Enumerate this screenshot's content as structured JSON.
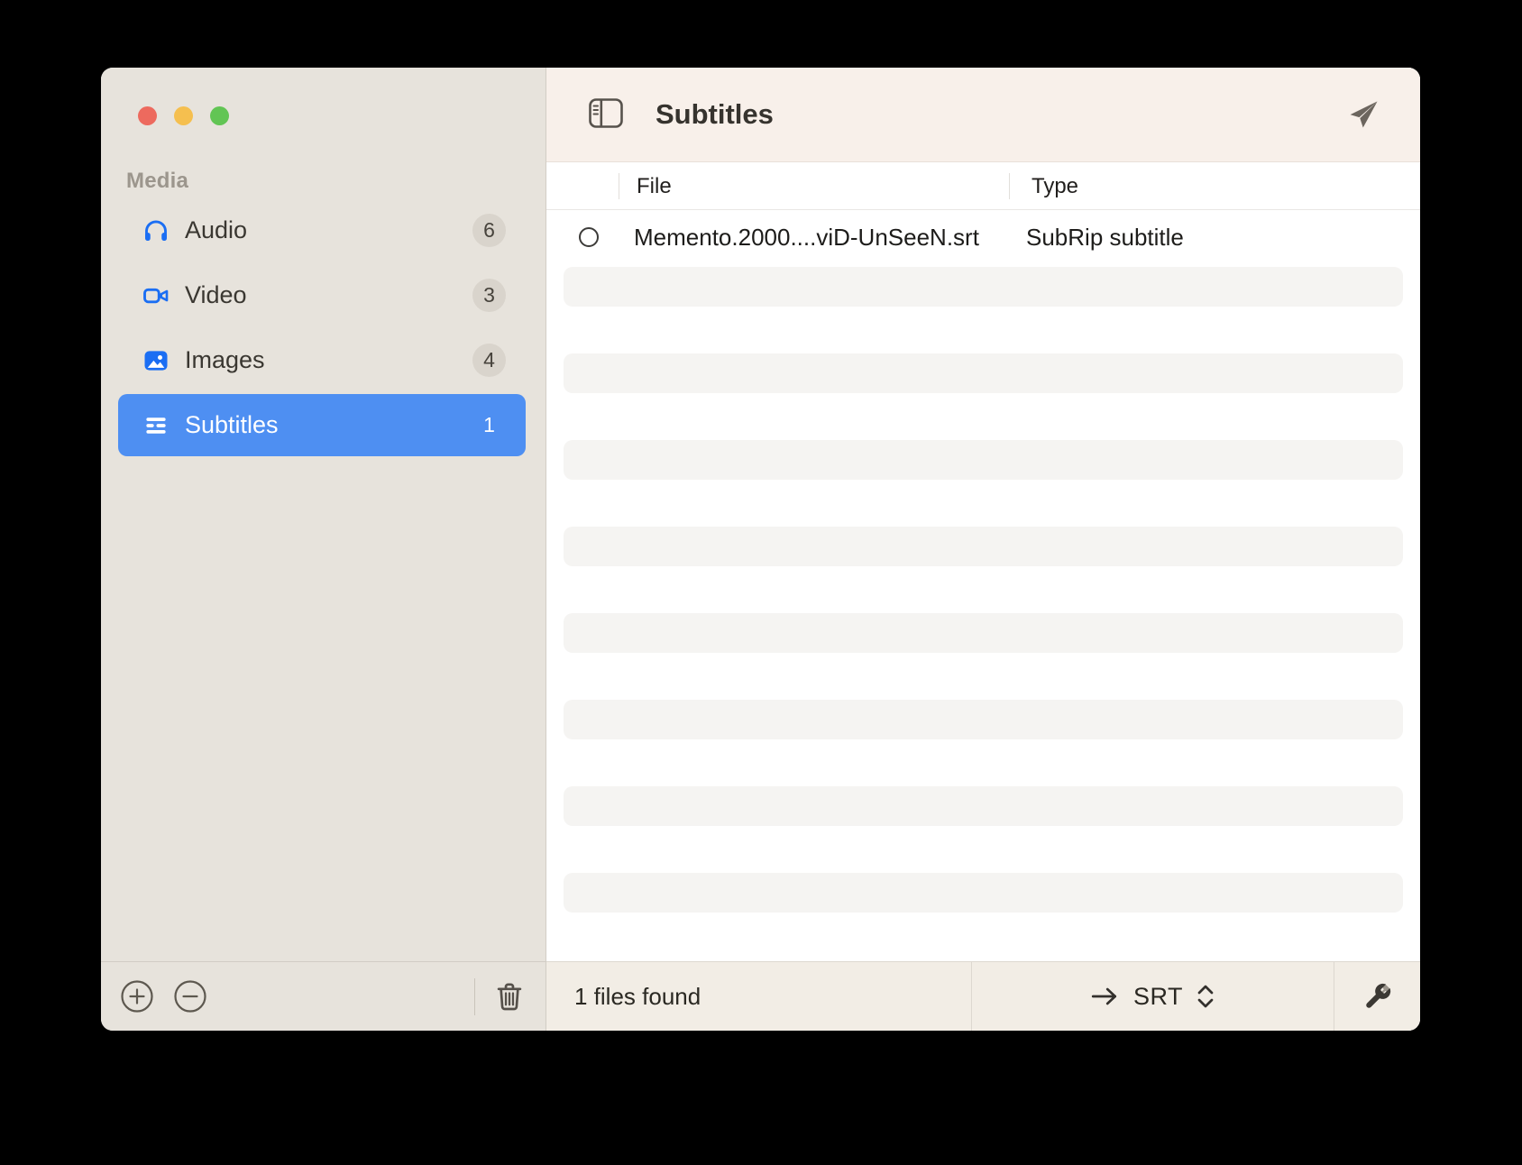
{
  "window": {
    "traffic_lights": {
      "close": "close",
      "minimize": "minimize",
      "zoom": "zoom"
    }
  },
  "sidebar": {
    "section_label": "Media",
    "items": [
      {
        "label": "Audio",
        "count": "6",
        "icon": "headphones-icon",
        "selected": false
      },
      {
        "label": "Video",
        "count": "3",
        "icon": "video-camera-icon",
        "selected": false
      },
      {
        "label": "Images",
        "count": "4",
        "icon": "image-icon",
        "selected": false
      },
      {
        "label": "Subtitles",
        "count": "1",
        "icon": "subtitles-icon",
        "selected": true
      }
    ]
  },
  "header": {
    "title": "Subtitles",
    "icons": [
      "sidebar-toggle-icon",
      "send-icon"
    ]
  },
  "table": {
    "columns": [
      {
        "label": "File"
      },
      {
        "label": "Type"
      }
    ],
    "rows": [
      {
        "file": "Memento.2000....viD-UnSeeN.srt",
        "type": "SubRip subtitle",
        "checked": false
      }
    ],
    "placeholder_row_count": 8
  },
  "footer": {
    "status": "1 files found",
    "output_format": "SRT",
    "icons": [
      "plus-circle-icon",
      "minus-circle-icon",
      "trash-icon",
      "arrow-right-icon",
      "chevron-up-down-icon",
      "tools-icon"
    ]
  },
  "colors": {
    "accent_blue": "#4e8ff2",
    "icon_blue": "#1b6ef3",
    "sidebar_bg": "#e7e3dc",
    "titlebar_bg": "#f8f0ea",
    "footer_bg": "#f2ede5",
    "placeholder": "#f5f4f2",
    "traffic_close": "#ed6a5e",
    "traffic_minimize": "#f5bf4f",
    "traffic_zoom": "#62c554"
  }
}
